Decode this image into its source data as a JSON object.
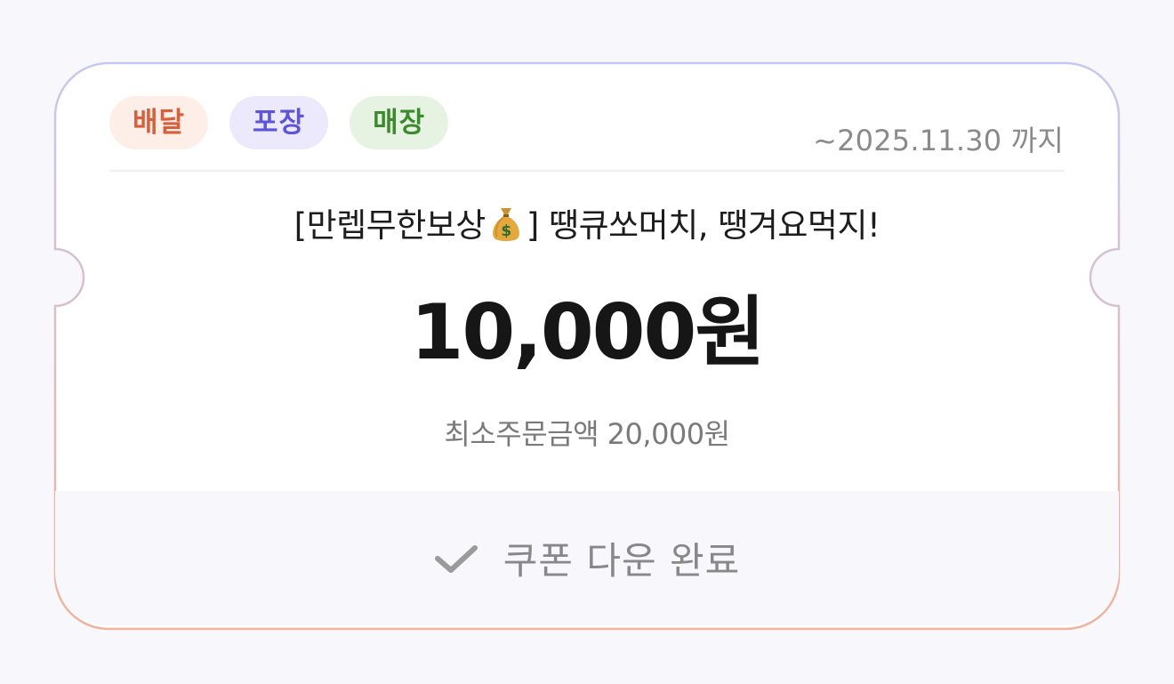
{
  "coupon": {
    "tags": {
      "delivery": "배달",
      "pickup": "포장",
      "dinein": "매장"
    },
    "expiry": "~2025.11.30 까지",
    "title_prefix": "[만렙무한보상",
    "title_suffix": "] 땡큐쏘머치, 땡겨요먹지!",
    "title_emoji_icon": "money-bag-icon",
    "amount": "10,000원",
    "min_order": "최소주문금액 20,000원",
    "status_label": "쿠폰 다운 완료",
    "status_icon": "checkmark-icon"
  },
  "colors": {
    "page_bg": "#f7f7fc",
    "border_top": "#c6c9ef",
    "border_bottom": "#f0b39c",
    "tag_delivery": "#d85f3b",
    "tag_pickup": "#5d55d6",
    "tag_dinein": "#3b8a2e"
  }
}
